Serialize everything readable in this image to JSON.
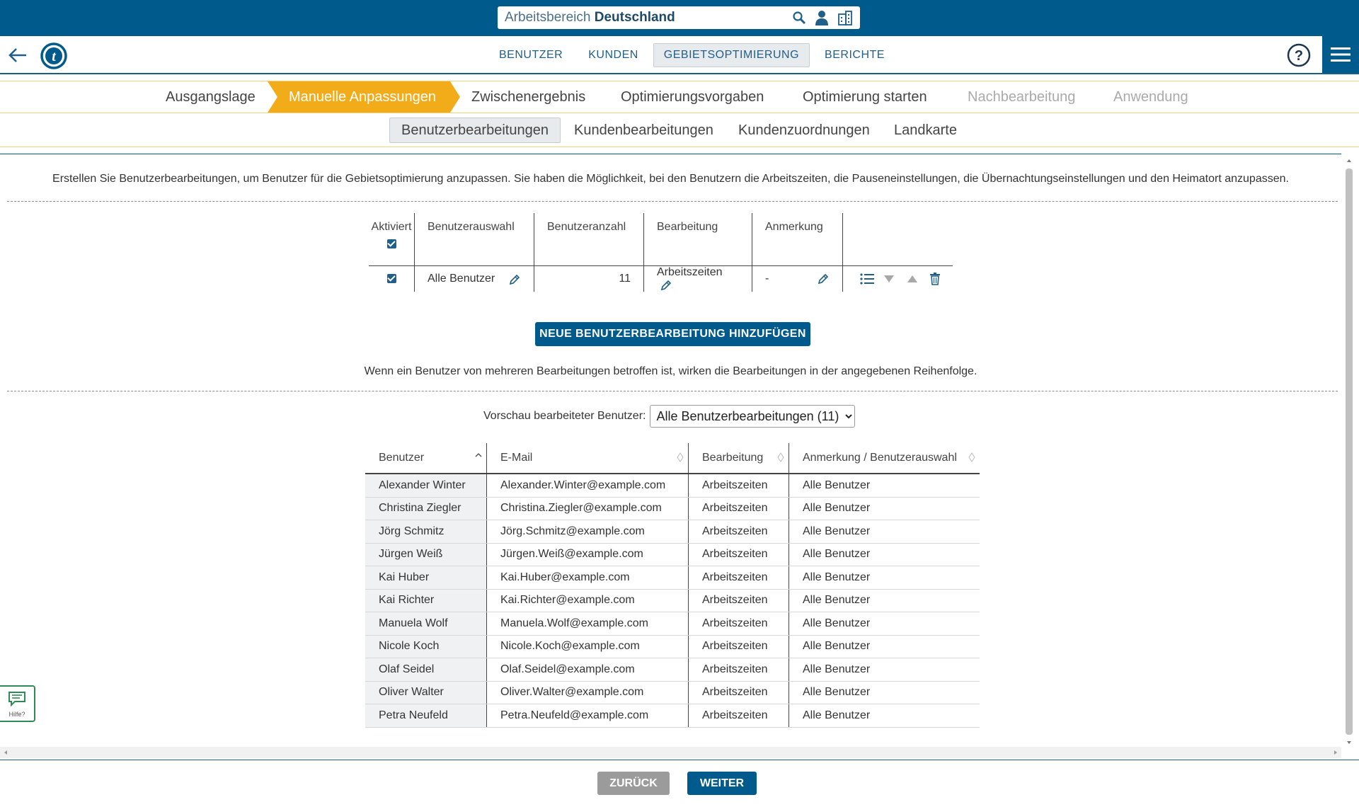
{
  "workspace": {
    "prefix": "Arbeitsbereich",
    "name": "Deutschland"
  },
  "nav": {
    "tabs": [
      "BENUTZER",
      "KUNDEN",
      "GEBIETSOPTIMIERUNG",
      "BERICHTE"
    ],
    "active": "GEBIETSOPTIMIERUNG"
  },
  "steps": [
    "Ausgangslage",
    "Manuelle Anpassungen",
    "Zwischenergebnis",
    "Optimierungsvorgaben",
    "Optimierung starten",
    "Nachbearbeitung",
    "Anwendung"
  ],
  "subtabs": [
    "Benutzerbearbeitungen",
    "Kundenbearbeitungen",
    "Kundenzuordnungen",
    "Landkarte"
  ],
  "intro": "Erstellen Sie Benutzerbearbeitungen, um Benutzer für die Gebietsoptimierung anzupassen. Sie haben die Möglichkeit, bei den Benutzern die Arbeitszeiten, die Pauseneinstellungen, die Übernachtungseinstellungen und den Heimatort anzupassen.",
  "rules": {
    "headers": [
      "Aktiviert",
      "Benutzerauswahl",
      "Benutzeranzahl",
      "Bearbeitung",
      "Anmerkung"
    ],
    "row": {
      "auswahl": "Alle Benutzer",
      "anzahl": "11",
      "bearbeitung": "Arbeitszeiten",
      "anmerkung": "-"
    }
  },
  "add_button": "NEUE BENUTZERBEARBEITUNG HINZUFÜGEN",
  "order_note": "Wenn ein Benutzer von mehreren Bearbeitungen betroffen ist, wirken die Bearbeitungen in der angegebenen Reihenfolge.",
  "preview": {
    "label": "Vorschau bearbeiteter Benutzer:",
    "selected": "Alle Benutzerbearbeitungen (11)"
  },
  "users": {
    "headers": [
      "Benutzer",
      "E-Mail",
      "Bearbeitung",
      "Anmerkung / Benutzerauswahl"
    ],
    "rows": [
      [
        "Alexander Winter",
        "Alexander.Winter@example.com",
        "Arbeitszeiten",
        "Alle Benutzer"
      ],
      [
        "Christina Ziegler",
        "Christina.Ziegler@example.com",
        "Arbeitszeiten",
        "Alle Benutzer"
      ],
      [
        "Jörg Schmitz",
        "Jörg.Schmitz@example.com",
        "Arbeitszeiten",
        "Alle Benutzer"
      ],
      [
        "Jürgen Weiß",
        "Jürgen.Weiß@example.com",
        "Arbeitszeiten",
        "Alle Benutzer"
      ],
      [
        "Kai Huber",
        "Kai.Huber@example.com",
        "Arbeitszeiten",
        "Alle Benutzer"
      ],
      [
        "Kai Richter",
        "Kai.Richter@example.com",
        "Arbeitszeiten",
        "Alle Benutzer"
      ],
      [
        "Manuela Wolf",
        "Manuela.Wolf@example.com",
        "Arbeitszeiten",
        "Alle Benutzer"
      ],
      [
        "Nicole Koch",
        "Nicole.Koch@example.com",
        "Arbeitszeiten",
        "Alle Benutzer"
      ],
      [
        "Olaf Seidel",
        "Olaf.Seidel@example.com",
        "Arbeitszeiten",
        "Alle Benutzer"
      ],
      [
        "Oliver Walter",
        "Oliver.Walter@example.com",
        "Arbeitszeiten",
        "Alle Benutzer"
      ],
      [
        "Petra Neufeld",
        "Petra.Neufeld@example.com",
        "Arbeitszeiten",
        "Alle Benutzer"
      ]
    ]
  },
  "footer": {
    "back": "ZURÜCK",
    "next": "WEITER"
  },
  "hilfe": "Hilfe?",
  "colors": {
    "brand": "#005b8c",
    "step_active": "#f2ac1a",
    "help_border": "#2e8b57"
  }
}
